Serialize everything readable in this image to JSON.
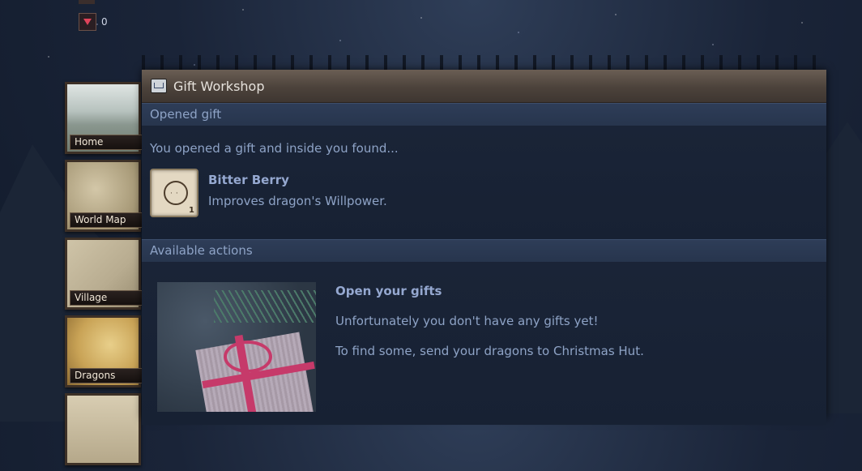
{
  "resources": {
    "gems": "0"
  },
  "side_nav": {
    "items": [
      {
        "label": "Home"
      },
      {
        "label": "World Map"
      },
      {
        "label": "Village"
      },
      {
        "label": "Dragons"
      },
      {
        "label": ""
      }
    ]
  },
  "dialog": {
    "title": "Gift Workshop",
    "opened_gift": {
      "heading": "Opened gift",
      "intro": "You opened a gift and inside you found...",
      "item": {
        "name": "Bitter Berry",
        "description": "Improves dragon's Willpower.",
        "count": "1"
      }
    },
    "actions": {
      "heading": "Available actions",
      "title": "Open your gifts",
      "line1": "Unfortunately you don't have any gifts yet!",
      "line2": "To find some, send your dragons to Christmas Hut."
    }
  }
}
